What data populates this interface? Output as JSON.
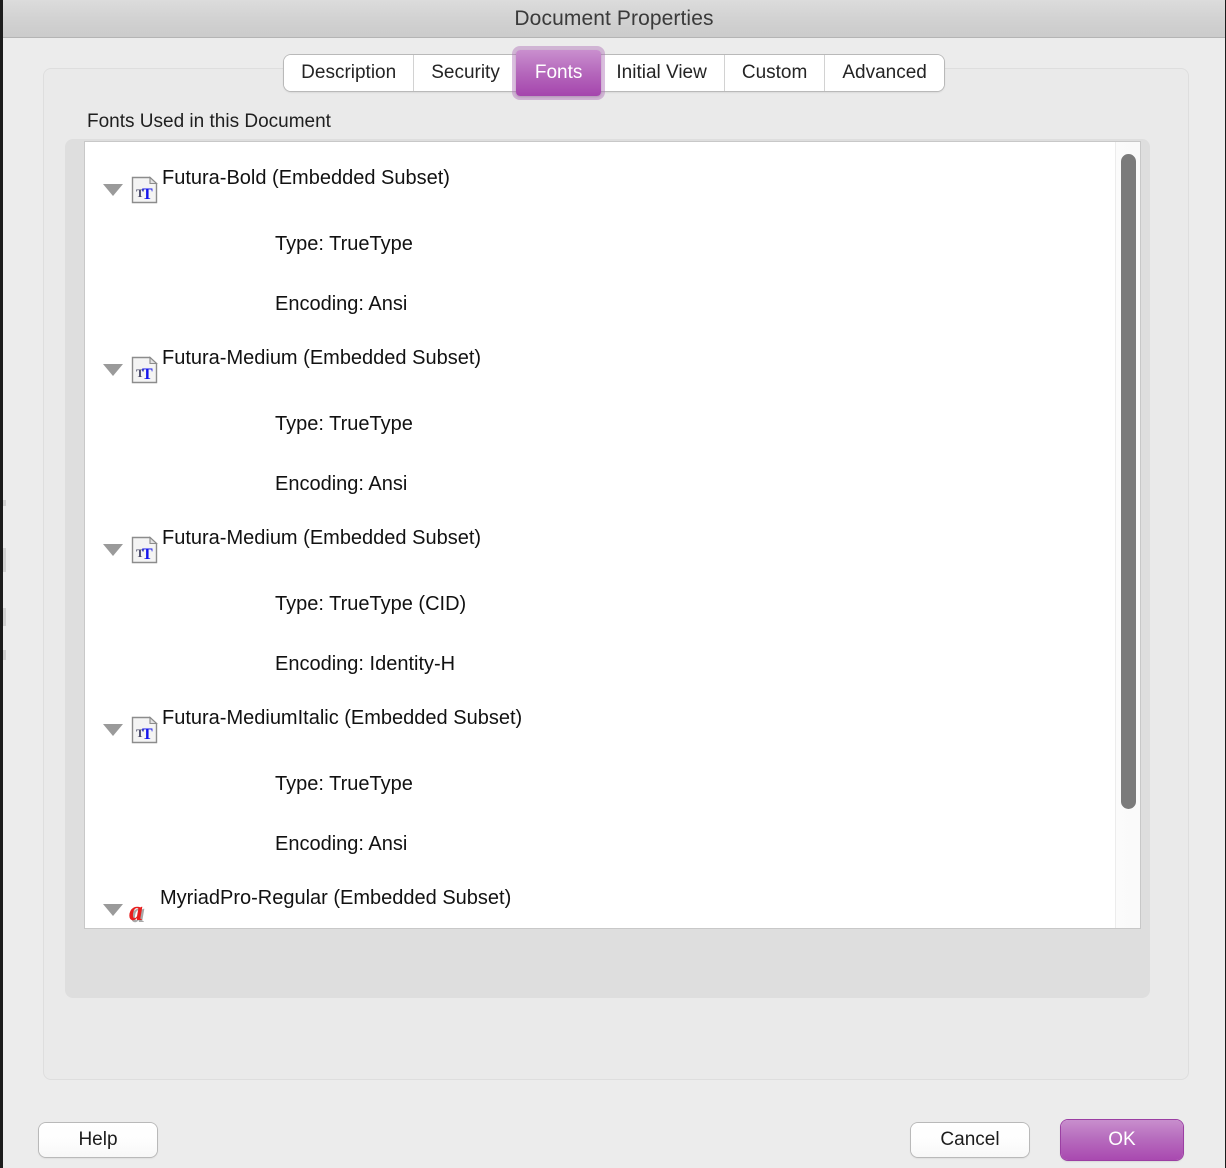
{
  "window": {
    "title": "Document Properties"
  },
  "tabs": [
    {
      "label": "Description",
      "selected": false
    },
    {
      "label": "Security",
      "selected": false
    },
    {
      "label": "Fonts",
      "selected": true
    },
    {
      "label": "Initial View",
      "selected": false
    },
    {
      "label": "Custom",
      "selected": false
    },
    {
      "label": "Advanced",
      "selected": false
    }
  ],
  "fonts_panel": {
    "group_label": "Fonts Used in this Document",
    "entries": [
      {
        "name": "Futura-Bold (Embedded Subset)",
        "icon": "truetype-icon",
        "expanded": true,
        "type": "Type: TrueType",
        "encoding": "Encoding: Ansi"
      },
      {
        "name": "Futura-Medium (Embedded Subset)",
        "icon": "truetype-icon",
        "expanded": true,
        "type": "Type: TrueType",
        "encoding": "Encoding: Ansi"
      },
      {
        "name": "Futura-Medium (Embedded Subset)",
        "icon": "truetype-icon",
        "expanded": true,
        "type": "Type: TrueType (CID)",
        "encoding": "Encoding: Identity-H"
      },
      {
        "name": "Futura-MediumItalic (Embedded Subset)",
        "icon": "truetype-icon",
        "expanded": true,
        "type": "Type: TrueType",
        "encoding": "Encoding: Ansi"
      },
      {
        "name": "MyriadPro-Regular (Embedded Subset)",
        "icon": "opentype-icon",
        "expanded": true,
        "type": null,
        "encoding": null
      }
    ]
  },
  "buttons": {
    "help": "Help",
    "cancel": "Cancel",
    "ok": "OK"
  },
  "colors": {
    "accent": "#b76dbe",
    "accent_dark": "#a949b0",
    "truetype_glyph": "#1414ec",
    "opentype_glyph": "#e81f1f",
    "window_bg": "#ececec",
    "panel_bg": "#eaeaea",
    "groupbox_bg": "#dedede",
    "list_bg": "#ffffff",
    "scrollbar_thumb": "#7b7b7b"
  }
}
